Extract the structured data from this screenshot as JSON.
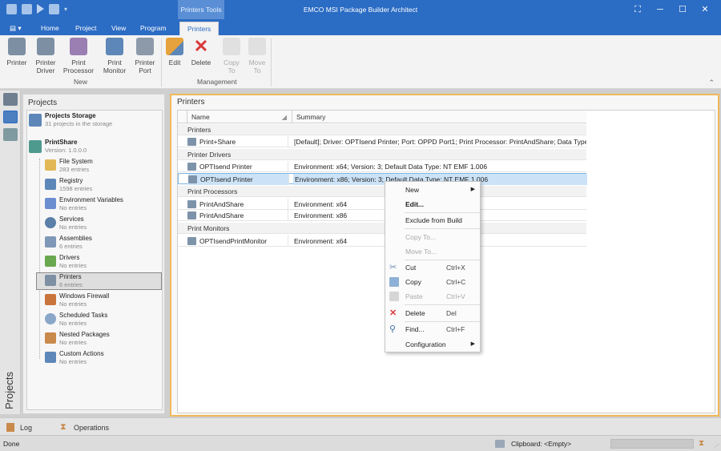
{
  "window": {
    "title": "EMCO MSI Package Builder Architect",
    "context_tab_header": "Printers Tools",
    "controls": [
      "restore-icon",
      "minimize-icon",
      "maximize-icon",
      "close-icon"
    ]
  },
  "ribbon_tabs": [
    "Home",
    "Project",
    "View",
    "Program",
    "Printers"
  ],
  "ribbon": {
    "new_group": {
      "label": "New",
      "buttons": [
        "Printer",
        "Printer Driver",
        "Print Processor",
        "Print Monitor",
        "Printer Port"
      ]
    },
    "management_group": {
      "label": "Management",
      "buttons": [
        "Edit",
        "Delete",
        "Copy To",
        "Move To"
      ]
    }
  },
  "projects_panel": {
    "title": "Projects",
    "side_label": "Projects",
    "storage": {
      "title": "Projects Storage",
      "subtitle": "31 projects in the storage"
    },
    "project": {
      "title": "PrintShare",
      "subtitle": "Version: 1.0.0.0"
    },
    "items": [
      {
        "name": "File System",
        "count": "283 entries"
      },
      {
        "name": "Registry",
        "count": "1598 entries"
      },
      {
        "name": "Environment Variables",
        "count": "No entries"
      },
      {
        "name": "Services",
        "count": "No entries"
      },
      {
        "name": "Assemblies",
        "count": "6 entries"
      },
      {
        "name": "Drivers",
        "count": "No entries"
      },
      {
        "name": "Printers",
        "count": "6 entries"
      },
      {
        "name": "Windows Firewall",
        "count": "No entries"
      },
      {
        "name": "Scheduled Tasks",
        "count": "No entries"
      },
      {
        "name": "Nested Packages",
        "count": "No entries"
      },
      {
        "name": "Custom Actions",
        "count": "No entries"
      }
    ]
  },
  "content": {
    "title": "Printers",
    "columns": {
      "name": "Name",
      "summary": "Summary"
    },
    "groups": {
      "printers": "Printers",
      "drivers": "Printer Drivers",
      "processors": "Print Processors",
      "monitors": "Print Monitors"
    },
    "rows": {
      "printer1": {
        "name": "Print+Share",
        "summary": "[Default]; Driver: OPTIsend Printer; Port: OPPD Port1; Print Processor: PrintAndShare; Data Type: NT"
      },
      "driver1": {
        "name": "OPTIsend Printer",
        "summary": "Environment: x64; Version: 3; Default Data Type: NT EMF 1.006"
      },
      "driver2": {
        "name": "OPTIsend Printer",
        "summary": "Environment: x86; Version: 3; Default Data Type: NT EMF 1.006"
      },
      "proc1": {
        "name": "PrintAndShare",
        "summary": "Environment: x64"
      },
      "proc2": {
        "name": "PrintAndShare",
        "summary": "Environment: x86"
      },
      "mon1": {
        "name": "OPTIsendPrintMonitor",
        "summary": "Environment: x64"
      }
    }
  },
  "context_menu": {
    "new": "New",
    "edit": "Edit...",
    "exclude": "Exclude from Build",
    "copy_to": "Copy To...",
    "move_to": "Move To...",
    "cut": {
      "label": "Cut",
      "key": "Ctrl+X"
    },
    "copy": {
      "label": "Copy",
      "key": "Ctrl+C"
    },
    "paste": {
      "label": "Paste",
      "key": "Ctrl+V"
    },
    "delete": {
      "label": "Delete",
      "key": "Del"
    },
    "find": {
      "label": "Find...",
      "key": "Ctrl+F"
    },
    "configuration": "Configuration"
  },
  "bottom_tabs": [
    "Log",
    "Operations"
  ],
  "status": {
    "text": "Done",
    "clipboard": "Clipboard: <Empty>"
  },
  "colors": {
    "title_bar": "#2b6cc4",
    "selection": "#cce3f7",
    "focus_border": "#f0b85a",
    "delete_red": "#d9383a"
  }
}
